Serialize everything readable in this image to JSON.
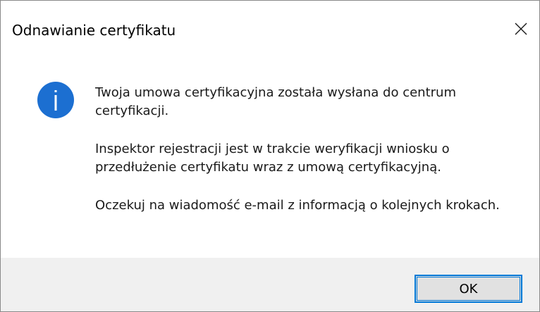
{
  "dialog": {
    "title": "Odnawianie certyfikatu",
    "close_icon": "close-icon",
    "info_icon": "info-icon",
    "messages": [
      "Twoja umowa certyfikacyjna została wysłana do centrum certyfikacji.",
      "Inspektor rejestracji jest w trakcie weryfikacji wniosku o przedłużenie certyfikatu wraz z umową certyfikacyjną.",
      "Oczekuj na wiadomość e-mail z informacją o kolejnych krokach."
    ],
    "ok_label": "OK"
  },
  "colors": {
    "accent": "#0078d7",
    "footer_bg": "#f0f0f0",
    "button_bg": "#e1e1e1"
  }
}
